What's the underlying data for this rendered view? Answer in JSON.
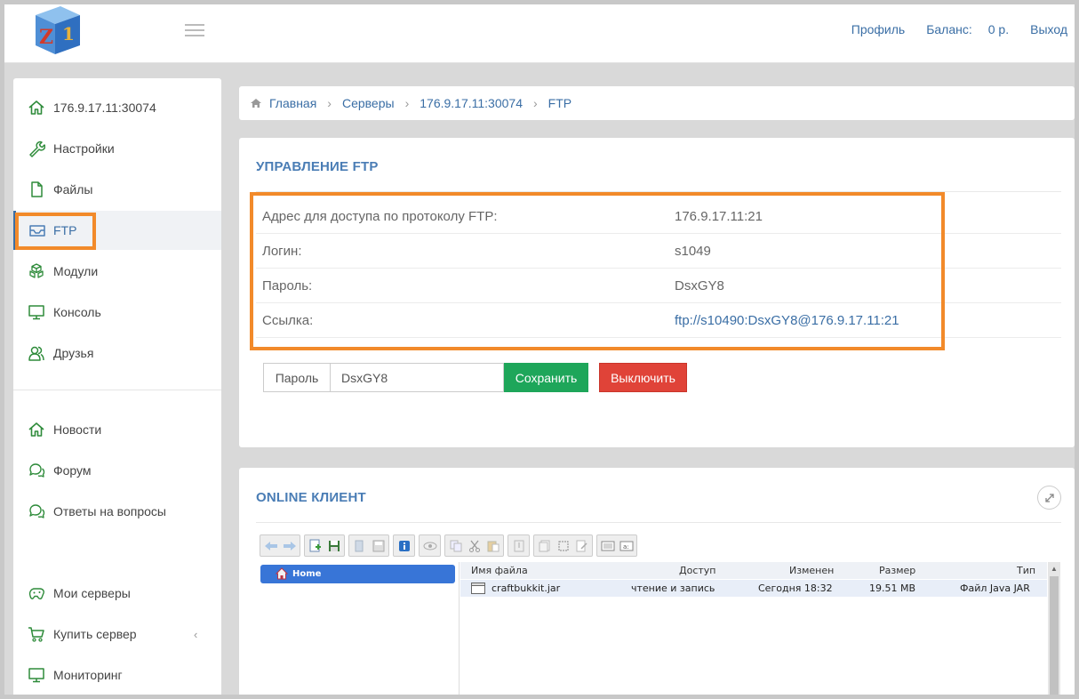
{
  "header": {
    "profile": "Профиль",
    "balance_label": "Баланс:",
    "balance_value": "0 р.",
    "logout": "Выход"
  },
  "sidebar": {
    "items": [
      {
        "label": "176.9.17.11:30074",
        "icon": "home-icon"
      },
      {
        "label": "Настройки",
        "icon": "wrench-icon"
      },
      {
        "label": "Файлы",
        "icon": "file-icon"
      },
      {
        "label": "FTP",
        "icon": "inbox-icon"
      },
      {
        "label": "Модули",
        "icon": "cubes-icon"
      },
      {
        "label": "Консоль",
        "icon": "monitor-icon"
      },
      {
        "label": "Друзья",
        "icon": "users-icon"
      },
      {
        "label": "Новости",
        "icon": "home-icon"
      },
      {
        "label": "Форум",
        "icon": "chat-icon"
      },
      {
        "label": "Ответы на вопросы",
        "icon": "chat-icon"
      },
      {
        "label": "Мои серверы",
        "icon": "gamepad-icon"
      },
      {
        "label": "Купить сервер",
        "icon": "cart-icon"
      },
      {
        "label": "Мониторинг",
        "icon": "monitor-icon"
      }
    ]
  },
  "breadcrumb": [
    "Главная",
    "Серверы",
    "176.9.17.11:30074",
    "FTP"
  ],
  "ftp": {
    "title": "УПРАВЛЕНИЕ FTP",
    "rows": [
      {
        "key": "Адрес для доступа по протоколу FTP:",
        "value": "176.9.17.11:21"
      },
      {
        "key": "Логин:",
        "value": "s1049"
      },
      {
        "key": "Пароль:",
        "value": "DsxGY8"
      },
      {
        "key": "Ссылка:",
        "value": "ftp://s10490:DsxGY8@176.9.17.11:21"
      }
    ],
    "password_addon": "Пароль",
    "password_value": "DsxGY8",
    "save_label": "Сохранить",
    "disable_label": "Выключить"
  },
  "client": {
    "title": "ONLINE КЛИЕНТ",
    "tree_home": "Home",
    "columns": [
      "Имя файла",
      "Доступ",
      "Изменен",
      "Размер",
      "Тип"
    ],
    "files": [
      {
        "name": "craftbukkit.jar",
        "access": "чтение и запись",
        "modified": "Сегодня 18:32",
        "size": "19.51 MB",
        "type": "Файл Java JAR"
      }
    ]
  },
  "colors": {
    "accent": "#3a6ea5",
    "sidebar_icon": "#2e8b3a",
    "save": "#1ea65a",
    "disable": "#e04338",
    "highlight": "#f28a2a"
  }
}
